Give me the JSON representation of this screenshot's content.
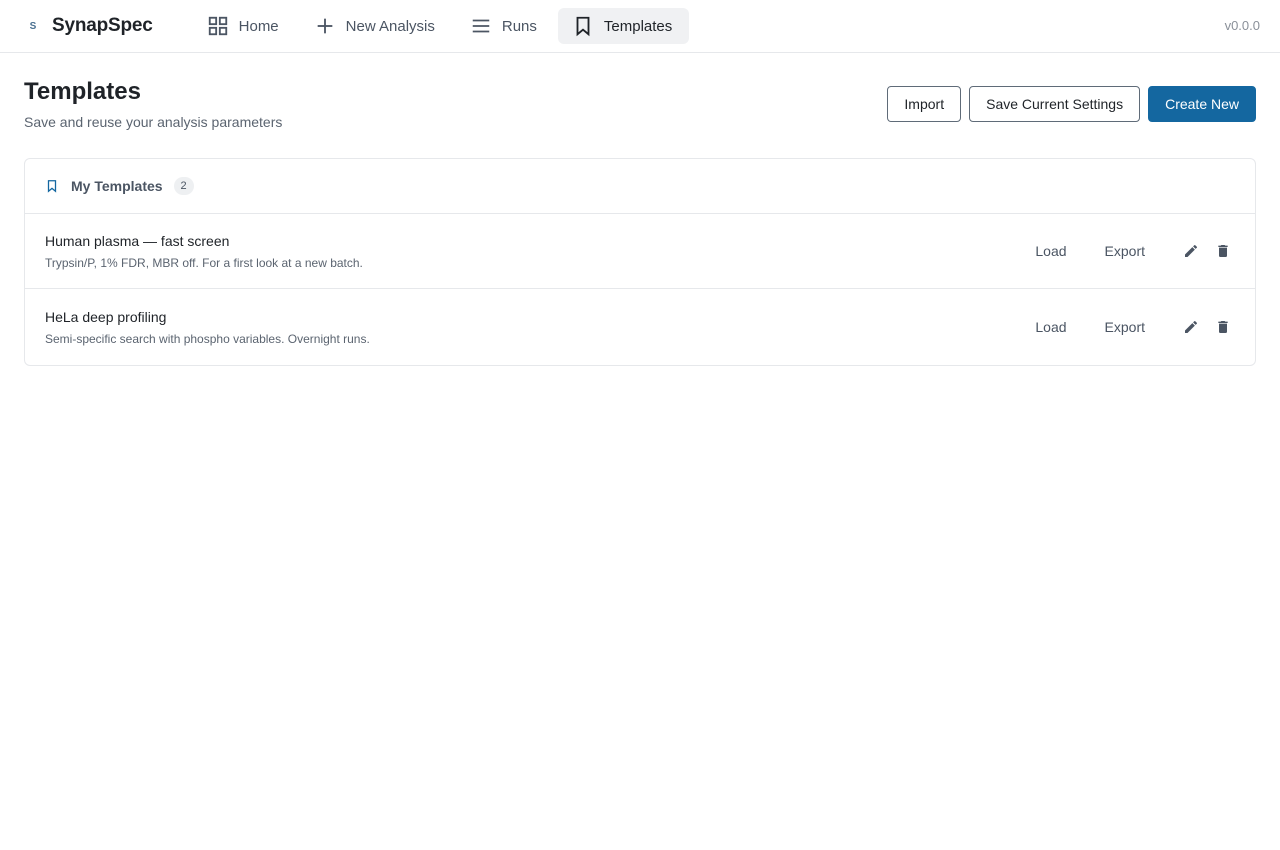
{
  "app": {
    "logo_letter": "S",
    "name": "SynapSpec",
    "version": "v0.0.0"
  },
  "nav": {
    "items": [
      {
        "label": "Home",
        "icon": "grid-icon"
      },
      {
        "label": "New Analysis",
        "icon": "plus-icon"
      },
      {
        "label": "Runs",
        "icon": "list-icon"
      },
      {
        "label": "Templates",
        "icon": "bookmark-icon",
        "active": true
      }
    ]
  },
  "page": {
    "title": "Templates",
    "subtitle": "Save and reuse your analysis parameters"
  },
  "actions": {
    "import_label": "Import",
    "save_current_label": "Save Current Settings",
    "create_new_label": "Create New"
  },
  "templates_card": {
    "title": "My Templates",
    "count": "2",
    "load_label": "Load",
    "export_label": "Export",
    "items": [
      {
        "name": "Human plasma — fast screen",
        "description": "Trypsin/P, 1% FDR, MBR off. For a first look at a new batch."
      },
      {
        "name": "HeLa deep profiling",
        "description": "Semi-specific search with phospho variables. Overnight runs."
      }
    ]
  },
  "colors": {
    "primary": "#1467a0",
    "active_nav_bg": "#f0f1f3",
    "border": "#e6e8eb"
  }
}
